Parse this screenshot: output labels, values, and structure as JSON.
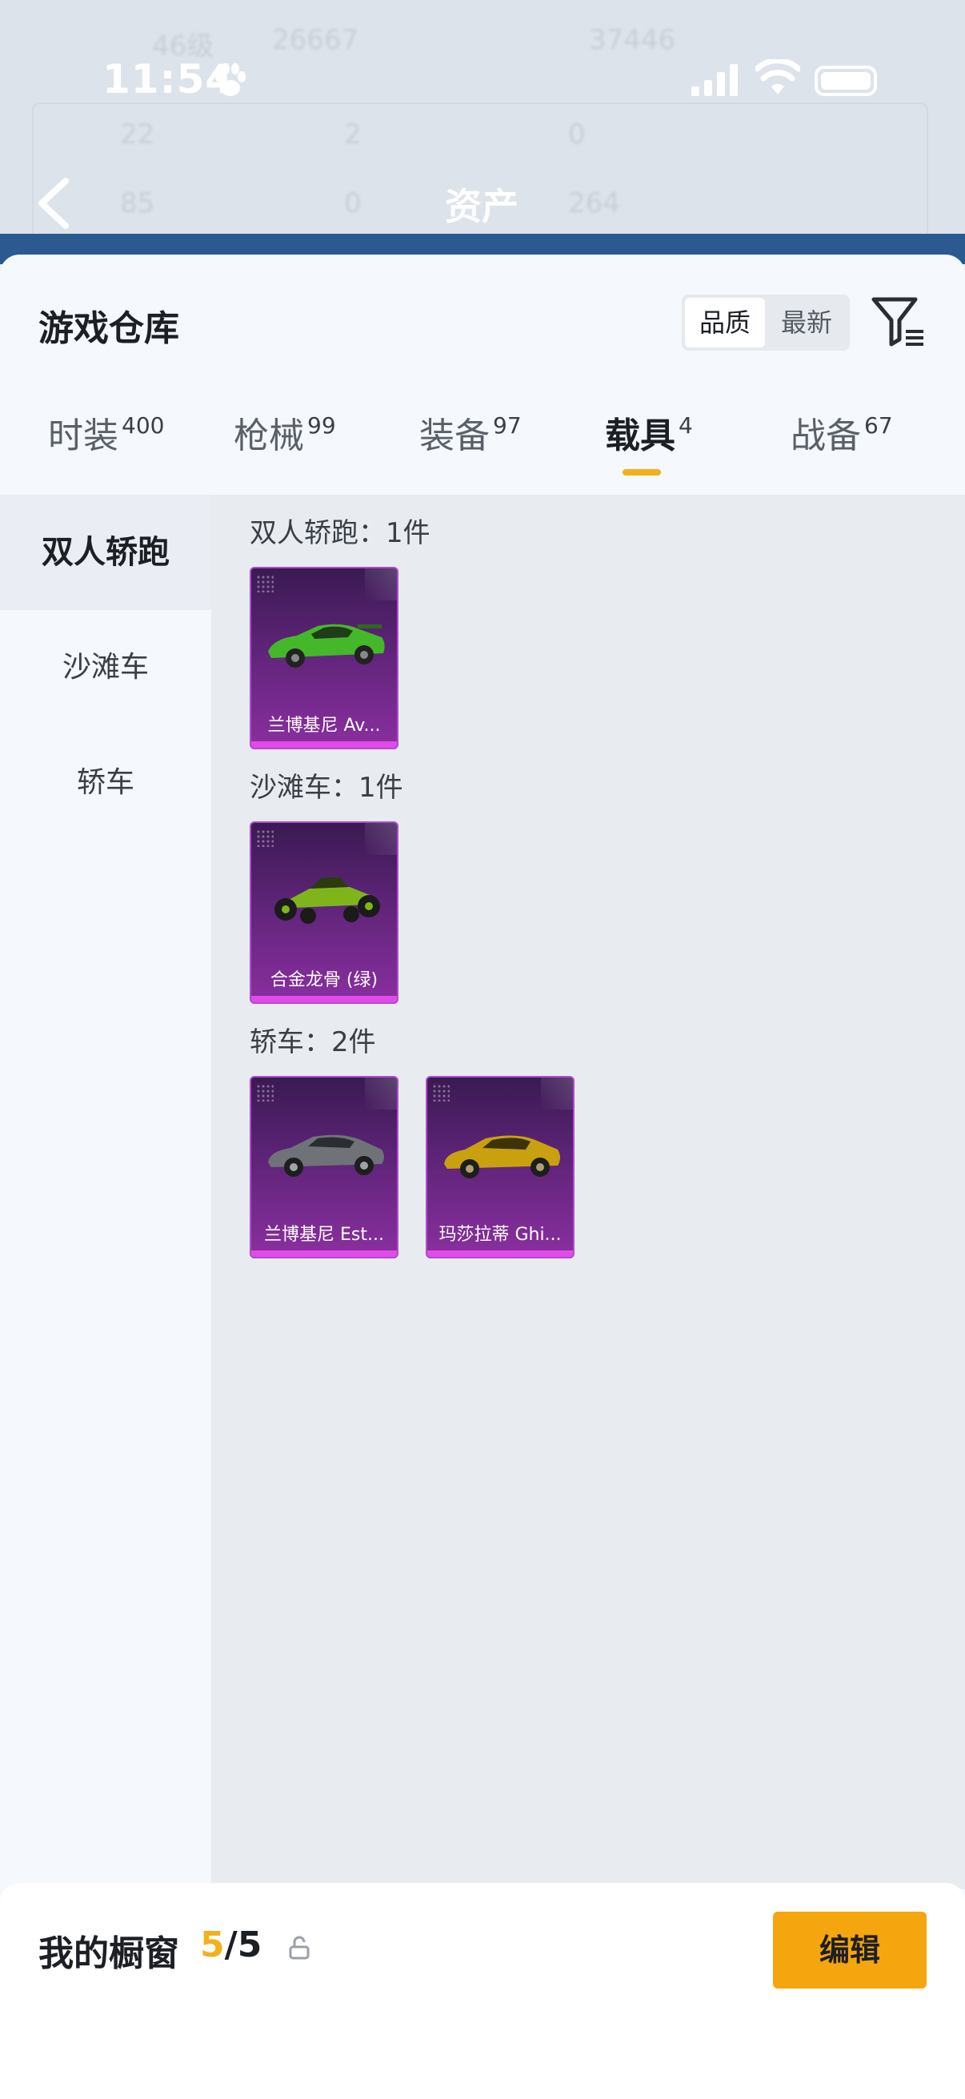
{
  "status_bar": {
    "time": "11:54"
  },
  "background_header": {
    "title": "资产",
    "faded_texts": [
      "46级",
      "26667",
      "37446",
      "22",
      "2",
      "0",
      "85",
      "0",
      "264"
    ]
  },
  "sheet": {
    "title": "游戏仓库"
  },
  "sort": {
    "quality": "品质",
    "newest": "最新",
    "selected": "品质"
  },
  "tabs": [
    {
      "label": "时装",
      "count": "400"
    },
    {
      "label": "枪械",
      "count": "99"
    },
    {
      "label": "装备",
      "count": "97"
    },
    {
      "label": "载具",
      "count": "4",
      "active": true
    },
    {
      "label": "战备",
      "count": "67"
    }
  ],
  "left_nav": [
    {
      "label": "双人轿跑",
      "active": true
    },
    {
      "label": "沙滩车"
    },
    {
      "label": "轿车"
    }
  ],
  "sections": [
    {
      "title": "双人轿跑：1件",
      "items": [
        {
          "name": "兰博基尼 Av...",
          "car_color": "#45b82a"
        }
      ]
    },
    {
      "title": "沙滩车：1件",
      "items": [
        {
          "name": "合金龙骨 (绿)",
          "car_color": "#7fb51a"
        }
      ]
    },
    {
      "title": "轿车：2件",
      "items": [
        {
          "name": "兰博基尼 Est...",
          "car_color": "#6f7378"
        },
        {
          "name": "玛莎拉蒂 Ghi...",
          "car_color": "#c9a10e"
        }
      ]
    }
  ],
  "showcase": {
    "label": "我的橱窗",
    "current": "5",
    "separator": "/",
    "total": "5",
    "edit_label": "编辑"
  },
  "colors": {
    "accent": "#f5a50e",
    "tab_underline": "#f2b01b",
    "card_purple": "#5e2478",
    "card_bar": "#e24be8"
  }
}
